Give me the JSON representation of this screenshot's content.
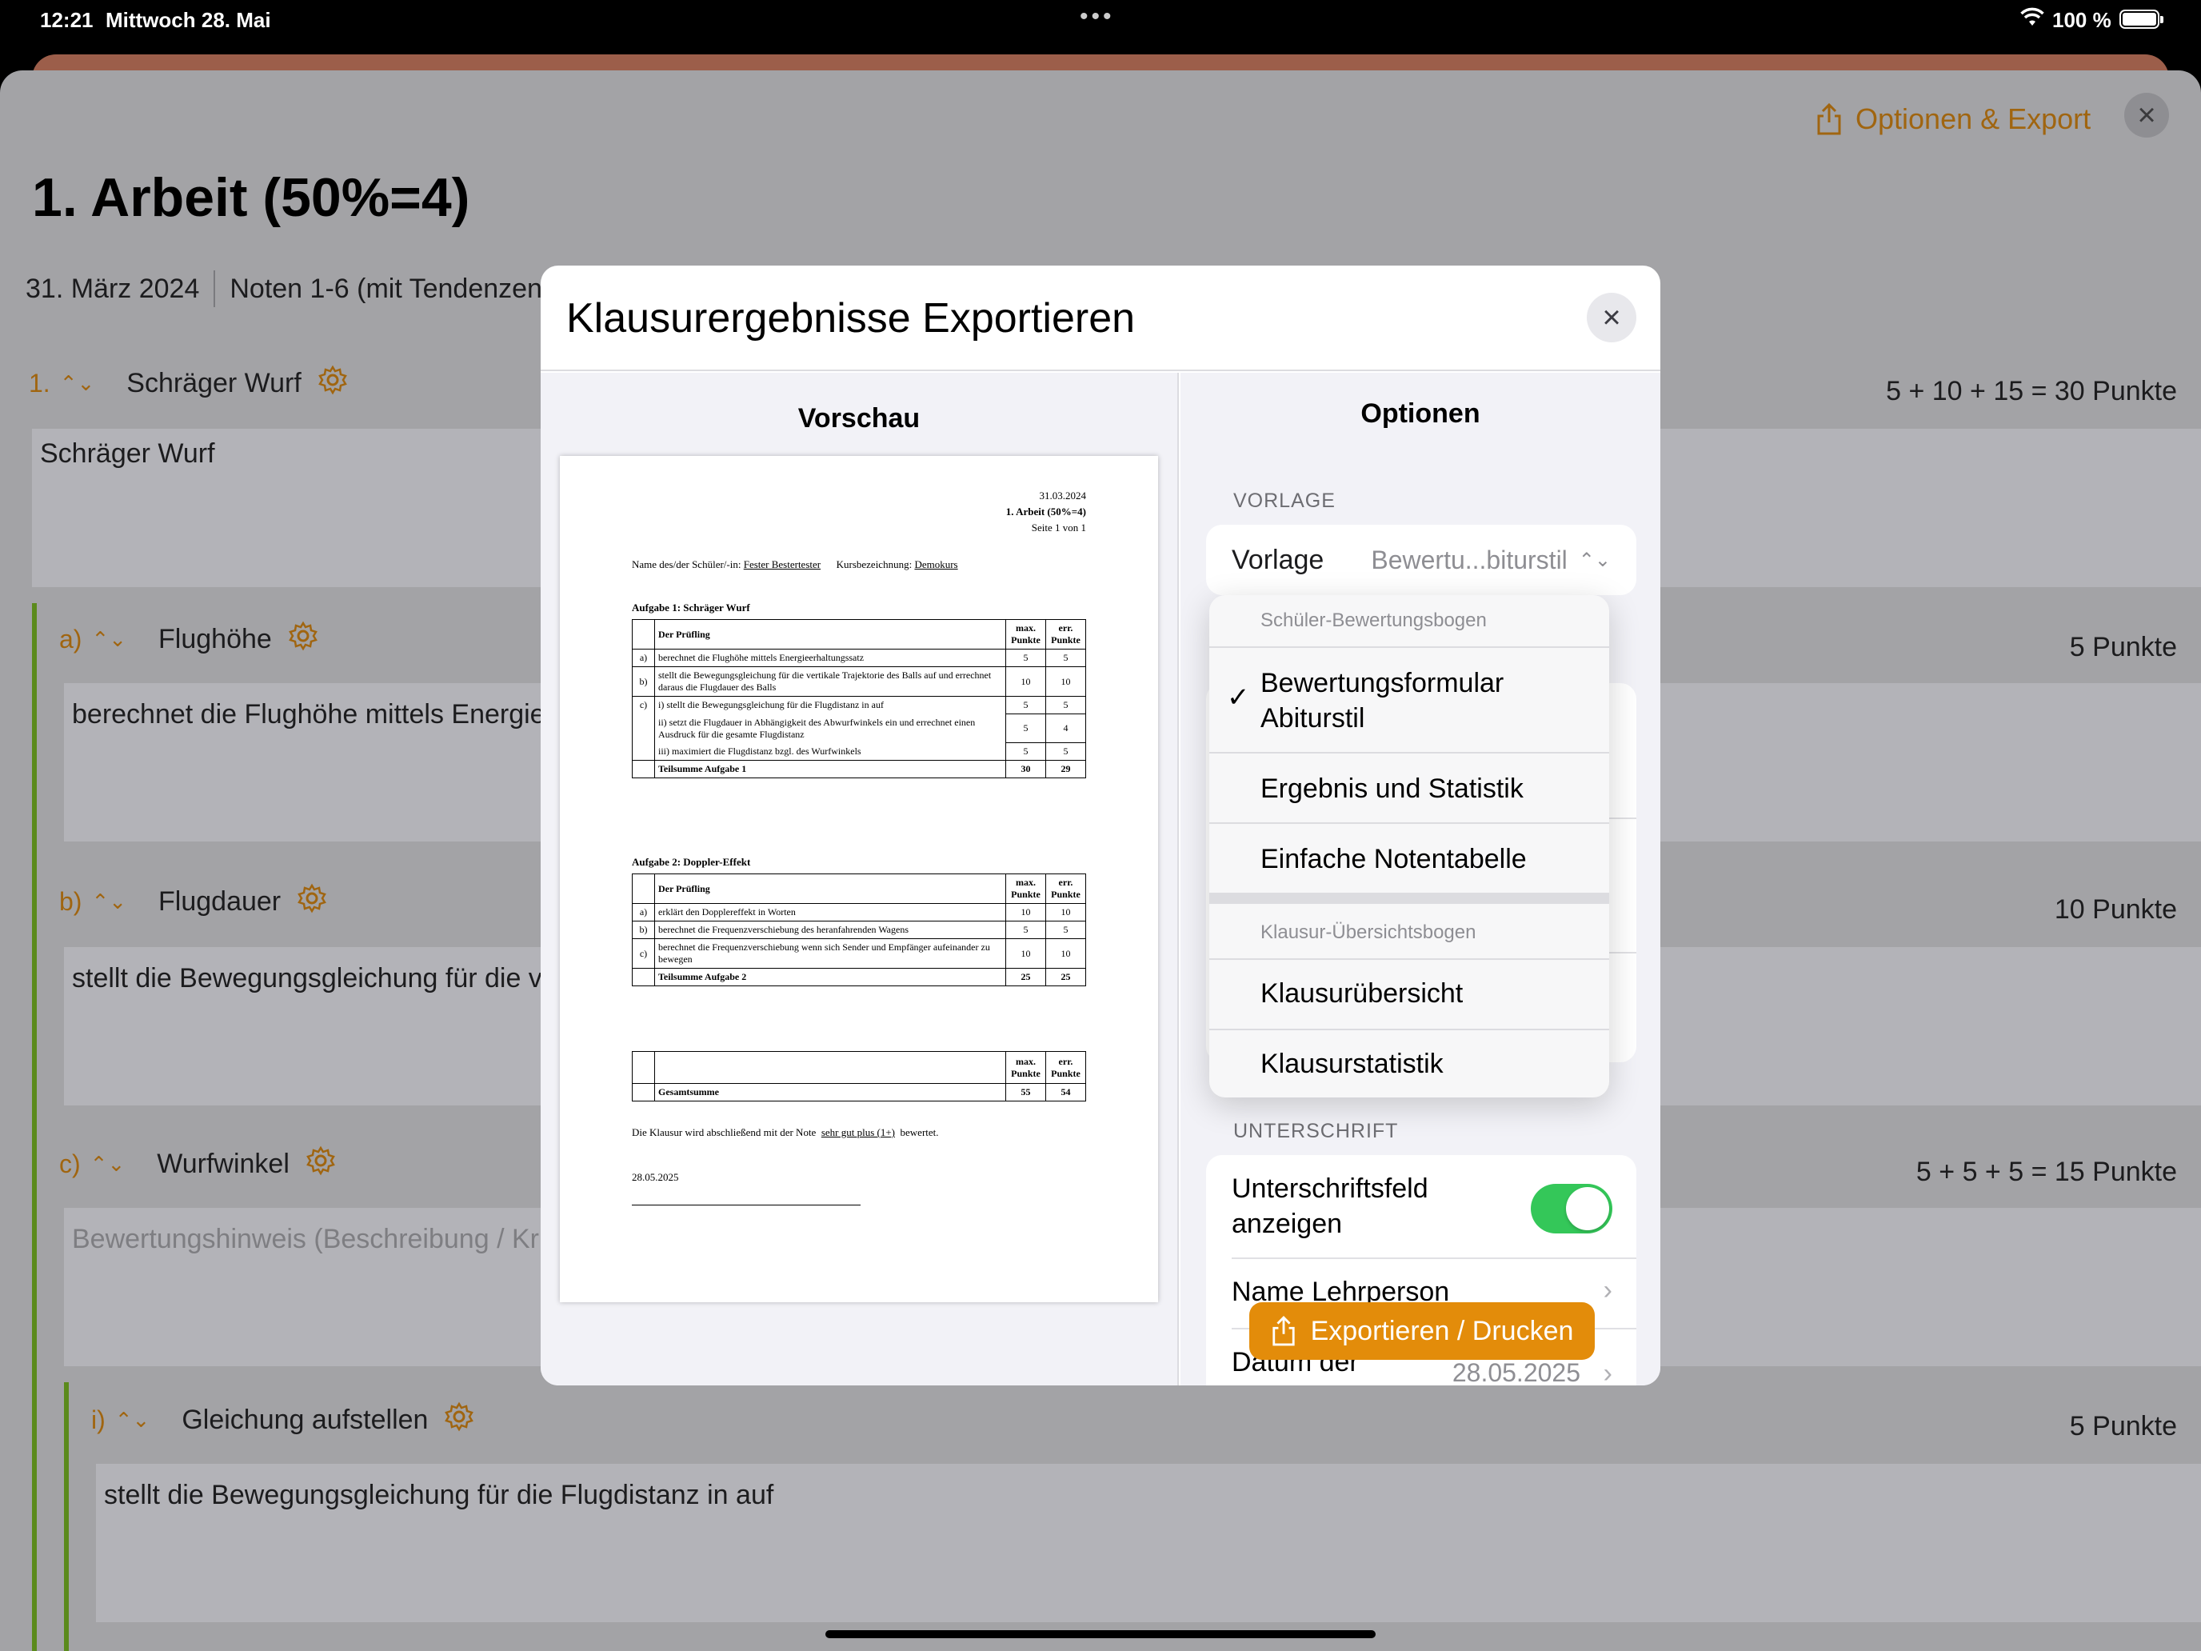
{
  "status_bar": {
    "time": "12:21",
    "date": "Mittwoch 28. Mai",
    "battery": "100 %"
  },
  "background": {
    "top_action": "Optionen & Export",
    "title": "1. Arbeit (50%=4)",
    "date": "31. März 2024",
    "grading": "Noten 1-6 (mit Tendenzen",
    "task": {
      "num": "1.",
      "title": "Schräger Wurf",
      "points": "5 + 10 + 15 = 30 Punkte",
      "description": "Schräger Wurf"
    },
    "subtasks": [
      {
        "num": "a)",
        "title": "Flughöhe",
        "points": "5 Punkte",
        "description": "berechnet die Flughöhe mittels Energie"
      },
      {
        "num": "b)",
        "title": "Flugdauer",
        "points": "10 Punkte",
        "description": "stellt die Bewegungsgleichung für die v"
      },
      {
        "num": "c)",
        "title": "Wurfwinkel",
        "points": "5 + 5 + 5 = 15 Punkte",
        "description": "Bewertungshinweis (Beschreibung / Kr"
      }
    ],
    "subsub": {
      "num": "i)",
      "title": "Gleichung aufstellen",
      "points": "5 Punkte",
      "description": "stellt die Bewegungsgleichung für die Flugdistanz in auf"
    }
  },
  "modal": {
    "title": "Klausurergebnisse Exportieren",
    "preview_title": "Vorschau",
    "options_title": "Optionen",
    "section_vorlage": "VORLAGE",
    "vorlage_label": "Vorlage",
    "vorlage_value": "Bewertu...biturstil",
    "section_unterschrift": "UNTERSCHRIFT",
    "toggle_label_1": "Unterschriftsfeld",
    "toggle_label_2": "anzeigen",
    "toggle_on": true,
    "name_label": "Name Lehrperson",
    "datum_label": "Datum der",
    "datum_value": "28.05.2025",
    "export_button": "Exportieren / Drucken"
  },
  "menu": {
    "group1": "Schüler-Bewertungsbogen",
    "item1_line1": "Bewertungsformular",
    "item1_line2": "Abiturstil",
    "item1_checked": true,
    "item2": "Ergebnis und Statistik",
    "item3": "Einfache Notentabelle",
    "group2": "Klausur-Übersichtsbogen",
    "item4": "Klausurübersicht",
    "item5": "Klausurstatistik"
  },
  "paper": {
    "date": "31.03.2024",
    "title": "1. Arbeit (50%=4)",
    "page": "Seite 1 von 1",
    "student_label": "Name des/der Schüler/-in:",
    "student_name": "Fester Bestertester",
    "course_label": "Kursbezeichnung:",
    "course_name": "Demokurs",
    "task1_title": "Aufgabe 1: Schräger Wurf",
    "task2_title": "Aufgabe 2: Doppler-Effekt",
    "col_pruefling": "Der Prüfling",
    "col_max_1": "max.",
    "col_max_2": "Punkte",
    "col_err_1": "err.",
    "col_err_2": "Punkte",
    "t1_a": "berechnet die Flughöhe mittels Energieerhaltungssatz",
    "t1_a_max": "5",
    "t1_a_err": "5",
    "t1_b": "stellt die Bewegungsgleichung für die vertikale Trajektorie des Balls auf und errechnet daraus die Flugdauer des Balls",
    "t1_b_max": "10",
    "t1_b_err": "10",
    "t1_c1": "i) stellt die Bewegungsgleichung für die Flugdistanz in auf",
    "t1_c1_max": "5",
    "t1_c1_err": "5",
    "t1_c2": "ii) setzt die Flugdauer in Abhängigkeit des Abwurfwinkels ein und errechnet einen Ausdruck für die gesamte Flugdistanz",
    "t1_c2_max": "5",
    "t1_c2_err": "4",
    "t1_c3": "iii) maximiert die Flugdistanz bzgl. des Wurfwinkels",
    "t1_c3_max": "5",
    "t1_c3_err": "5",
    "t1_sum": "Teilsumme Aufgabe 1",
    "t1_sum_max": "30",
    "t1_sum_err": "29",
    "t2_a": "erklärt den Dopplereffekt in Worten",
    "t2_a_max": "10",
    "t2_a_err": "10",
    "t2_b": "berechnet die Frequenzverschiebung des heranfahrenden Wagens",
    "t2_b_max": "5",
    "t2_b_err": "5",
    "t2_c": "berechnet die Frequenzverschiebung wenn sich Sender und Empfänger aufeinander zu bewegen",
    "t2_c_max": "10",
    "t2_c_err": "10",
    "t2_sum": "Teilsumme Aufgabe 2",
    "t2_sum_max": "25",
    "t2_sum_err": "25",
    "total_label": "Gesamtsumme",
    "total_max": "55",
    "total_err": "54",
    "grade_pre": "Die Klausur wird abschließend mit der Note",
    "grade": "sehr gut plus (1+)",
    "grade_post": "bewertet.",
    "sign_date": "28.05.2025",
    "row_a": "a)",
    "row_b": "b)",
    "row_c": "c)"
  },
  "colors": {
    "accent": "#e38c0a",
    "toggle_on": "#34c759",
    "bar": "#5b8a1c"
  }
}
